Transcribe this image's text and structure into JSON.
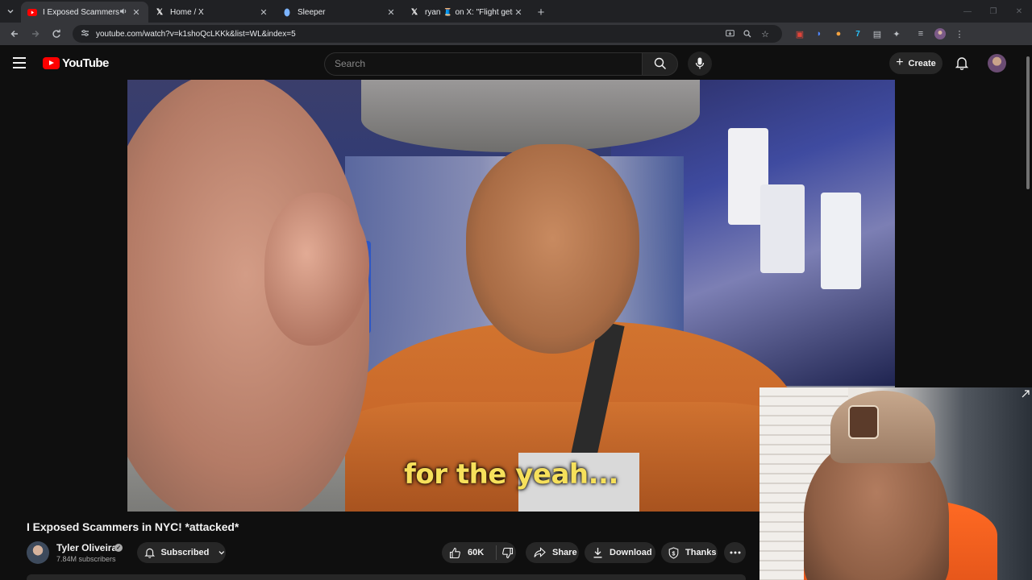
{
  "browser": {
    "tabs": [
      {
        "title": "I Exposed Scammers in NYC",
        "favicon": "youtube",
        "active": true,
        "audio": true
      },
      {
        "title": "Home / X",
        "favicon": "x",
        "active": false
      },
      {
        "title": "Sleeper",
        "favicon": "sleeper",
        "active": false
      },
      {
        "title": "ryan 🧵 on X: \"Flight gets exciting",
        "favicon": "x",
        "active": false
      }
    ],
    "url": "youtube.com/watch?v=k1shoQcLKKk&list=WL&index=5"
  },
  "header": {
    "logo_text": "YouTube",
    "search_placeholder": "Search",
    "create_label": "Create"
  },
  "video": {
    "caption": "for the yeah..."
  },
  "info": {
    "title": "I Exposed Scammers in NYC! *attacked*",
    "channel_name": "Tyler Oliveira",
    "subscribers": "7.84M subscribers",
    "subscribe_label": "Subscribed",
    "likes": "60K",
    "share_label": "Share",
    "download_label": "Download",
    "thanks_label": "Thanks"
  },
  "colors": {
    "accent": "#ff0000",
    "caption": "#f6e05b",
    "background": "#0f0f0f"
  }
}
